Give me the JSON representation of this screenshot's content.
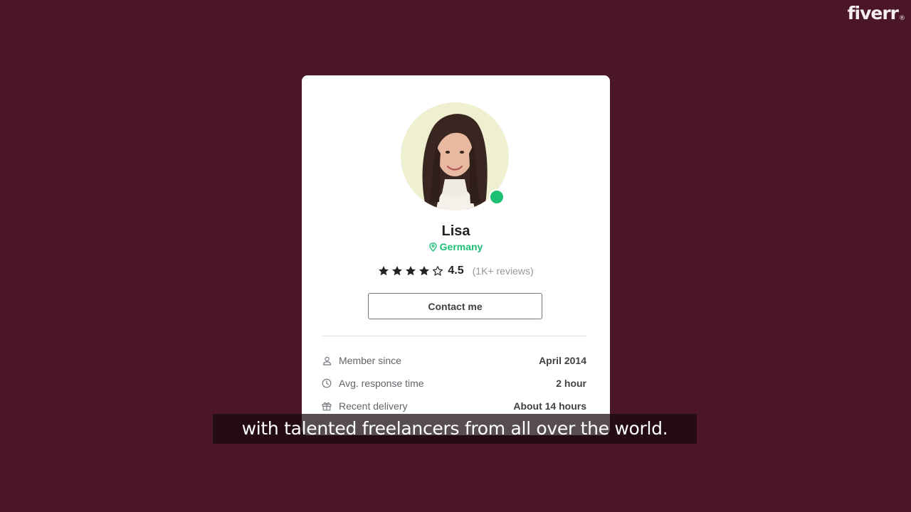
{
  "brand": {
    "logo_text": "fiverr",
    "logo_mark": "®"
  },
  "profile": {
    "name": "Lisa",
    "location": "Germany",
    "online": true,
    "rating": "4.5",
    "rating_fraction": 0.9,
    "stars_filled": 4,
    "stars_total": 5,
    "reviews": "(1K+ reviews)",
    "contact_label": "Contact me",
    "avatar_icon": "profile-photo"
  },
  "stats": [
    {
      "icon": "user-icon",
      "label": "Member since",
      "value": "April 2014"
    },
    {
      "icon": "clock-icon",
      "label": "Avg. response time",
      "value": "2 hour"
    },
    {
      "icon": "gift-icon",
      "label": "Recent delivery",
      "value": "About 14 hours"
    }
  ],
  "caption": {
    "text": "with talented freelancers from all over the world."
  },
  "colors": {
    "background": "#4b1727",
    "accent_green": "#1dbf73",
    "card": "#ffffff",
    "text_dark": "#222325",
    "text_muted": "#62646a"
  }
}
